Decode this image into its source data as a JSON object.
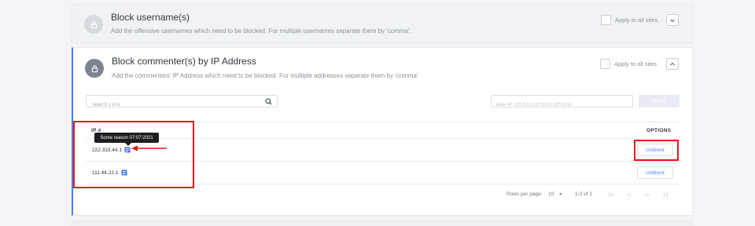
{
  "block_usernames": {
    "title": "Block username(s)",
    "description": "Add the offensive usernames which need to be blocked. For multiple usernames separate them by 'comma'.",
    "apply_label": "Apply to all sites",
    "toggle_icon": "chevron-down-icon"
  },
  "block_commenters": {
    "title": "Block commenter(s) by IP Address",
    "description": "Add the commenters' IP Address which need to be blocked. For multiple addresses separate them by 'comma'",
    "apply_label": "Apply to all sites",
    "toggle_icon": "chevron-up-icon",
    "search_placeholder": "Search 2 IP.s",
    "ip_input_placeholder": "Enter IP: 127.0.0.1,127.0.0.3-127.0.0.8",
    "block_button_label": "Block",
    "table": {
      "col_ip": "IP #",
      "col_options": "OPTIONS",
      "rows": [
        {
          "ip": "222.333.44.1",
          "tooltip": "Some reason 07:07:2021",
          "action": "Unblock"
        },
        {
          "ip": "111.44.22.1",
          "action": "Unblock"
        }
      ]
    },
    "pagination": {
      "rows_per_page_label": "Rows per page:",
      "rows_per_page_value": "10",
      "range": "1-2 of 2"
    }
  },
  "colors": {
    "accent": "#4a7ef0",
    "highlight": "#e3161b",
    "lock_active": "#7c8492",
    "lock_inactive": "#d6d9df"
  }
}
